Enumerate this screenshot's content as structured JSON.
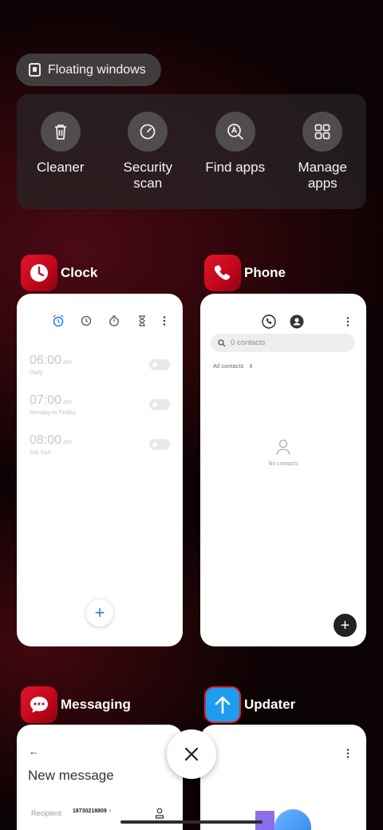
{
  "floating_windows": {
    "label": "Floating windows",
    "icon": "floating-window-icon"
  },
  "tools": [
    {
      "label": "Cleaner",
      "icon": "trash-icon"
    },
    {
      "label": "Security\nscan",
      "icon": "security-scan-icon"
    },
    {
      "label": "Find apps",
      "icon": "find-apps-icon"
    },
    {
      "label": "Manage\napps",
      "icon": "grid-icon"
    }
  ],
  "apps": {
    "clock": {
      "name": "Clock",
      "alarms": [
        {
          "time": "06:00",
          "ampm": "am",
          "repeat": "Daily"
        },
        {
          "time": "07:00",
          "ampm": "am",
          "repeat": "Monday to Friday"
        },
        {
          "time": "08:00",
          "ampm": "am",
          "repeat": "Sat Sun"
        }
      ]
    },
    "phone": {
      "name": "Phone",
      "search_placeholder": "0 contacts",
      "filter": "All contacts",
      "empty": "No contacts"
    },
    "messaging": {
      "name": "Messaging",
      "title": "New message",
      "recipient_label": "Recipient:",
      "recipient": "18730218809"
    },
    "updater": {
      "name": "Updater"
    }
  },
  "colors": {
    "accent_blue": "#2d7ef0",
    "brand_red": "#d0102a",
    "updater_blue": "#1e9df0"
  }
}
